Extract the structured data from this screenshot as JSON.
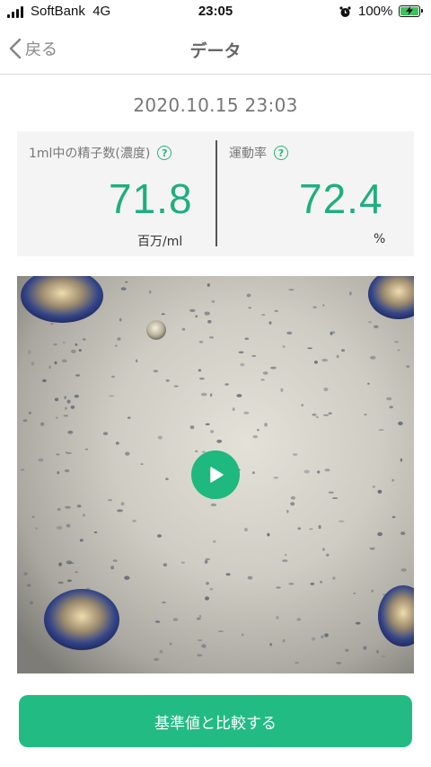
{
  "status_bar": {
    "carrier": "SoftBank",
    "network": "4G",
    "time": "23:05",
    "battery_percent": "100%",
    "battery_level": 1.0,
    "icons": [
      "signal-icon",
      "alarm-icon",
      "battery-charging-icon"
    ]
  },
  "nav": {
    "back_label": "戻る",
    "title": "データ",
    "icons": [
      "chevron-left-icon"
    ]
  },
  "record": {
    "datetime": "2020.10.15 23:03"
  },
  "stats": {
    "concentration": {
      "label": "1ml中の精子数(濃度)",
      "value": "71.8",
      "unit": "百万/ml",
      "help_glyph": "?"
    },
    "motility": {
      "label": "運動率",
      "value": "72.4",
      "unit": "%",
      "help_glyph": "?"
    }
  },
  "video": {
    "icons": [
      "play-icon"
    ]
  },
  "compare_button": {
    "label": "基準値と比較する"
  },
  "colors": {
    "accent": "#22bb83",
    "value_text": "#1fae7d",
    "card_bg": "#f4f4f4"
  }
}
